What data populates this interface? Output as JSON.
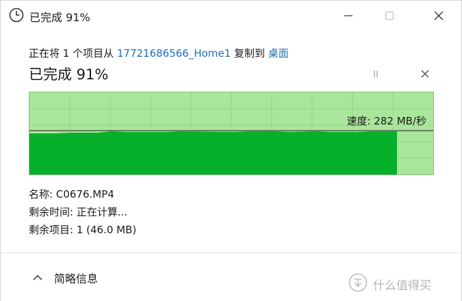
{
  "window": {
    "title": "已完成 91%"
  },
  "operation": {
    "prefix": "正在将 1 个项目从 ",
    "source": "17721686566_Home1",
    "middle": " 复制到 ",
    "destination": "桌面"
  },
  "progress": {
    "title": "已完成 91%",
    "percent": 91,
    "speed_label": "速度: 282 MB/秒",
    "speed_mb_per_s": 282
  },
  "details": {
    "name_label": "名称:",
    "name_value": "C0676.MP4",
    "time_label": "剩余时间:",
    "time_value": "正在计算...",
    "items_label": "剩余项目:",
    "items_value": "1 (46.0 MB)"
  },
  "footer": {
    "toggle_label": "简略信息"
  },
  "watermark": {
    "text": "什么值得买"
  },
  "colors": {
    "graph_bg": "#a9e59a",
    "graph_fill": "#06b02a",
    "link": "#1f6fb8"
  },
  "icons": {
    "title": "clock-icon",
    "minimize": "minimize-icon",
    "maximize": "maximize-icon",
    "close": "close-icon",
    "pause": "pause-icon",
    "cancel": "cancel-icon",
    "toggle": "chevron-up-icon",
    "watermark": "smzdm-logo-icon"
  }
}
